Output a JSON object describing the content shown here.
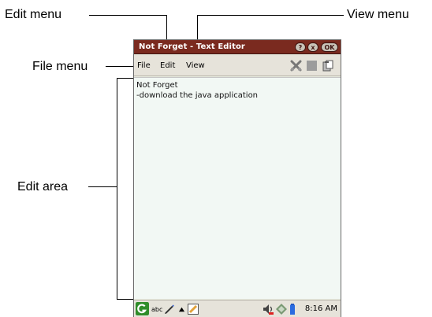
{
  "callouts": {
    "edit_menu": "Edit menu",
    "view_menu": "View menu",
    "file_menu": "File menu",
    "edit_area": "Edit area"
  },
  "window": {
    "title": "Not Forget - Text Editor",
    "help_label": "?",
    "close_label": "x",
    "ok_label": "OK"
  },
  "menubar": {
    "items": [
      {
        "label": "File"
      },
      {
        "label": "Edit"
      },
      {
        "label": "View"
      }
    ],
    "toolbar_icons": [
      "cut-icon",
      "copy-icon",
      "paste-icon"
    ]
  },
  "editor": {
    "lines": [
      "Not Forget",
      "-download the java application"
    ]
  },
  "taskbar": {
    "input_mode": "abc",
    "time": "8:16 AM",
    "icons": [
      "start-icon",
      "pen-icon",
      "up-arrow-icon",
      "keyboard-icon",
      "speaker-icon",
      "network-icon",
      "battery-icon"
    ]
  },
  "colors": {
    "titlebar": "#7a2a1f",
    "menubar": "#e6e3da",
    "edit_area": "#f2f8f4"
  }
}
